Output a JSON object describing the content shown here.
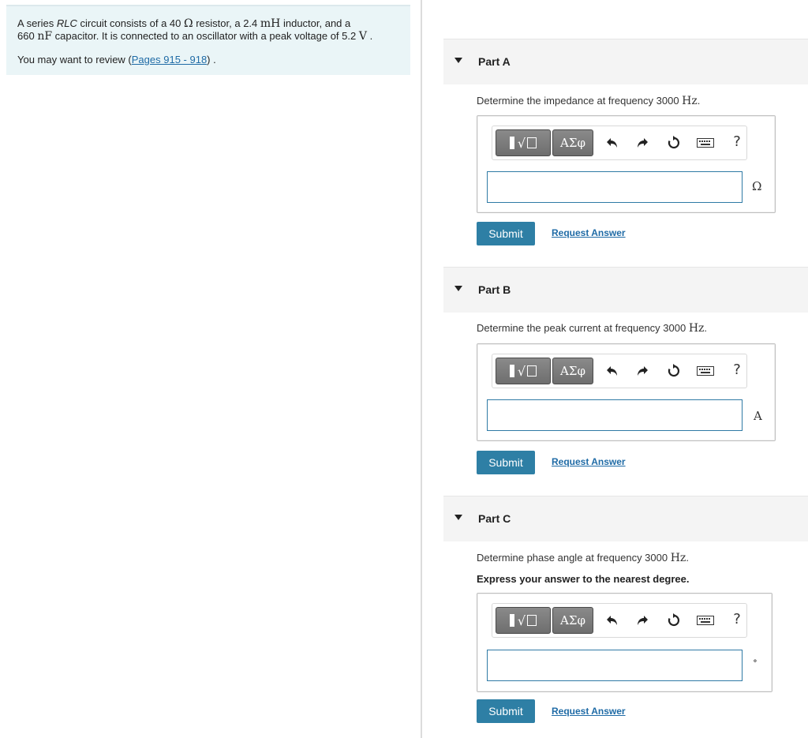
{
  "problem": {
    "line1_a": "A series ",
    "line1_rlc": "RLC",
    "line1_b": " circuit consists of a 40 ",
    "ohm": "Ω",
    "line1_c": " resistor, a 2.4 ",
    "mH": "mH",
    "line1_d": " inductor, and a",
    "line2_a": "660 ",
    "nF": "nF",
    "line2_b": " capacitor. It is connected to an oscillator with a peak voltage of 5.2 ",
    "V": "V",
    "line2_c": " .",
    "review_prefix": "You may want to review (",
    "review_link": "Pages 915 - 918",
    "review_suffix": ") ."
  },
  "toolbar": {
    "symbols_label": "ΑΣφ",
    "help_label": "?"
  },
  "parts": [
    {
      "label": "Part A",
      "question_prefix": "Determine the impedance at frequency 3000 ",
      "unit_hz": "Hz",
      "question_suffix": ".",
      "answer_unit": "Ω",
      "submit_label": "Submit",
      "request_label": "Request Answer"
    },
    {
      "label": "Part B",
      "question_prefix": "Determine the peak current at frequency 3000 ",
      "unit_hz": "Hz",
      "question_suffix": ".",
      "answer_unit": "A",
      "submit_label": "Submit",
      "request_label": "Request Answer"
    },
    {
      "label": "Part C",
      "question_prefix": "Determine phase angle at frequency 3000 ",
      "unit_hz": "Hz",
      "question_suffix": ".",
      "note": "Express your answer to the nearest degree.",
      "answer_unit": "∘",
      "submit_label": "Submit",
      "request_label": "Request Answer"
    }
  ]
}
